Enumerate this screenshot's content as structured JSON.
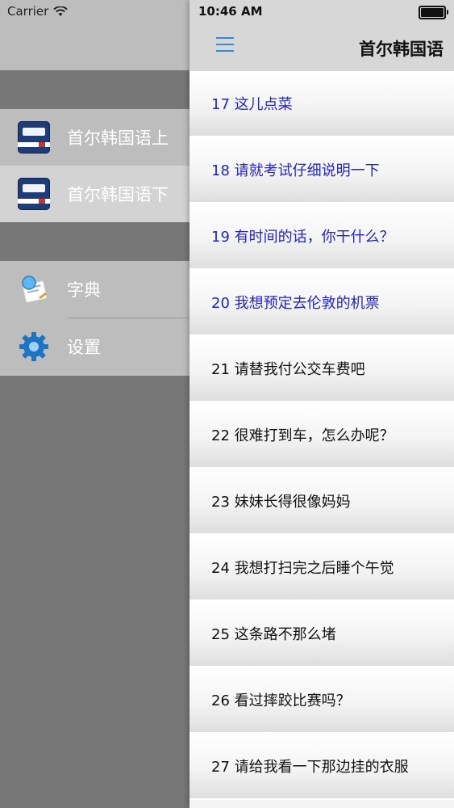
{
  "status_bar": {
    "carrier": "Carrier",
    "time": "10:46 AM"
  },
  "drawer": {
    "books": [
      {
        "label": "首尔韩国语上",
        "icon": "book-icon",
        "selected": false
      },
      {
        "label": "首尔韩国语下",
        "icon": "book-icon",
        "selected": true
      }
    ],
    "tools": [
      {
        "label": "字典",
        "icon": "dictionary-icon"
      },
      {
        "label": "设置",
        "icon": "gear-icon"
      }
    ]
  },
  "nav": {
    "title": "首尔韩国语",
    "menu_icon": "hamburger-icon",
    "accent": "#2f8fd6"
  },
  "lessons": [
    {
      "label": "17 这儿点菜",
      "viewed": true
    },
    {
      "label": "18 请就考试仔细说明一下",
      "viewed": true
    },
    {
      "label": "19 有时间的话，你干什么？",
      "viewed": true
    },
    {
      "label": "20 我想预定去伦敦的机票",
      "viewed": true
    },
    {
      "label": "21 请替我付公交车费吧",
      "viewed": false
    },
    {
      "label": "22 很难打到车，怎么办呢？",
      "viewed": false
    },
    {
      "label": "23 妹妹长得很像妈妈",
      "viewed": false
    },
    {
      "label": "24 我想打扫完之后睡个午觉",
      "viewed": false
    },
    {
      "label": "25 这条路不那么堵",
      "viewed": false
    },
    {
      "label": "26 看过摔跤比赛吗？",
      "viewed": false
    },
    {
      "label": "27 请给我看一下那边挂的衣服",
      "viewed": false
    }
  ],
  "colors": {
    "viewed_text": "#2323c8",
    "normal_text": "#111111"
  }
}
